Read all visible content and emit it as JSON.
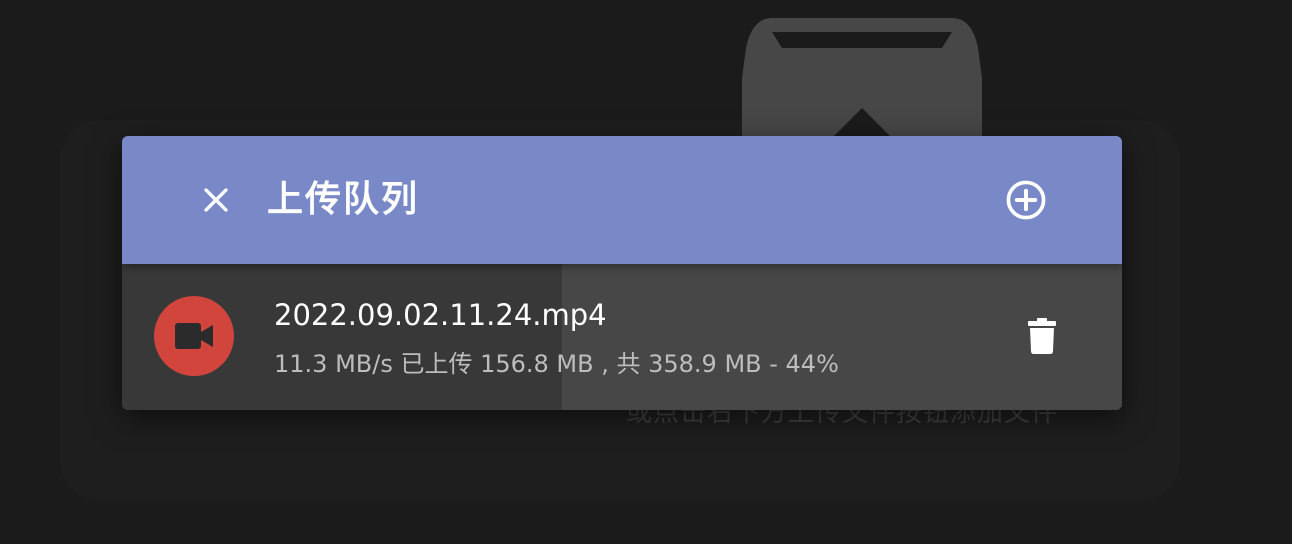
{
  "background": {
    "hint_text": "或点击右下方上传文件按钮添加文件"
  },
  "panel": {
    "title": "上传队列",
    "header_color": "#7989c8",
    "close_icon": "close-icon",
    "add_icon": "add-circle-icon"
  },
  "upload": {
    "file_name": "2022.09.02.11.24.mp4",
    "status": "11.3 MB/s 已上传 156.8 MB , 共 358.9 MB - 44%",
    "progress": 0.44,
    "file_icon": "video-camera-icon",
    "file_icon_color": "#d2453d",
    "delete_icon": "trash-icon"
  }
}
